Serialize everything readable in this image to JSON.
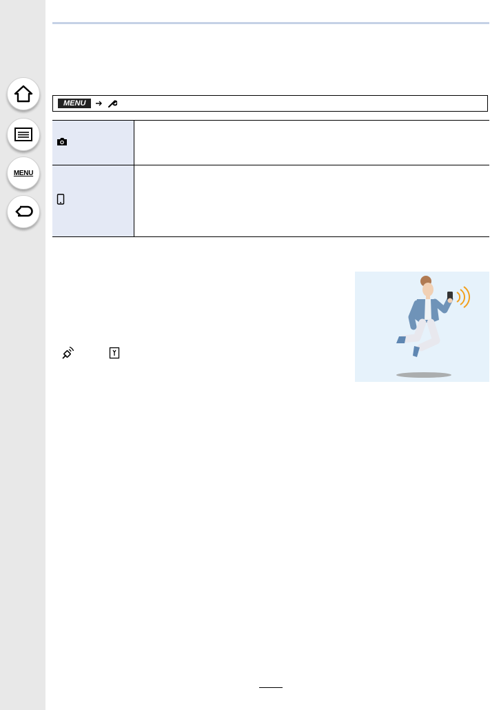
{
  "sidebar": {
    "buttons": [
      {
        "name": "home-button",
        "icon": "home-icon"
      },
      {
        "name": "contents-button",
        "icon": "list-icon"
      },
      {
        "name": "menu-button",
        "icon": "menu-icon",
        "label": "MENU"
      },
      {
        "name": "back-button",
        "icon": "return-icon"
      }
    ]
  },
  "menu_path": {
    "badge": "MENU",
    "icons": [
      "arrow-icon",
      "wrench-icon"
    ]
  },
  "settings_table": {
    "rows": [
      {
        "icon": "camera-icon",
        "description": ""
      },
      {
        "icon": "smartphone-icon",
        "description": ""
      }
    ]
  },
  "illustration": {
    "subject": "person-jumping-with-smartphone"
  },
  "colors": {
    "sidebar": "#e8e8e8",
    "table_label_bg": "#e4e9f5",
    "rule": "#c5d1e6",
    "signal": "#f2a01c",
    "illustration_bg": "#e6f2fb"
  }
}
